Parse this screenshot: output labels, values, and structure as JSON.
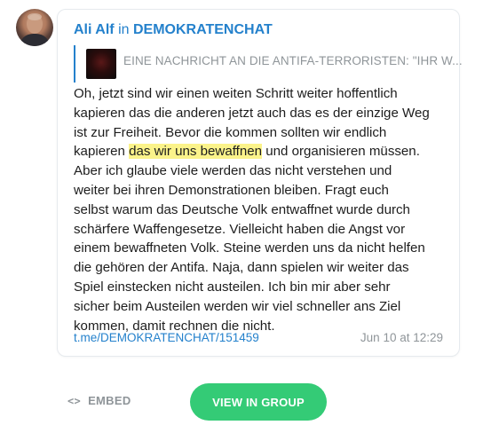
{
  "post": {
    "author": "Ali Alf",
    "in_word": "in",
    "channel": "DEMOKRATENCHAT",
    "reply_preview": "EINE NACHRICHT AN DIE ANTIFA-TERRORISTEN: \"IHR W...",
    "lines": [
      "Oh, jetzt sind wir einen weiten Schritt weiter hoffentlich",
      "kapieren das die anderen jetzt auch das es der einzige Weg",
      "ist zur Freiheit. Bevor die kommen sollten wir endlich",
      {
        "before": "kapieren ",
        "highlight": "das wir uns bewaffnen",
        "after": " und organisieren müssen."
      },
      "Aber ich glaube viele werden das nicht verstehen und",
      "weiter bei ihren Demonstrationen bleiben. Fragt euch",
      "selbst warum das Deutsche Volk entwaffnet wurde durch",
      "schärfere Waffengesetze. Vielleicht haben die Angst vor",
      "einem bewaffneten Volk. Steine werden uns da nicht helfen",
      "die gehören der Antifa. Naja, dann spielen wir weiter das",
      "Spiel einstecken nicht austeilen. Ich bin mir aber sehr",
      "sicher beim Austeilen werden wir viel schneller ans Ziel",
      "kommen, damit rechnen die nicht."
    ],
    "link": "t.me/DEMOKRATENCHAT/151459",
    "timestamp": "Jun 10 at 12:29"
  },
  "footer": {
    "embed_icon": "<>",
    "embed_label": "EMBED",
    "view_button_label": "VIEW IN GROUP"
  },
  "colors": {
    "accent": "#2481cc",
    "highlight": "#fbf38a",
    "button": "#34cb76",
    "muted": "#8f9599"
  },
  "icons": {
    "avatar": "user-avatar",
    "reply_thumb": "reply-thumbnail",
    "embed": "code-icon"
  }
}
